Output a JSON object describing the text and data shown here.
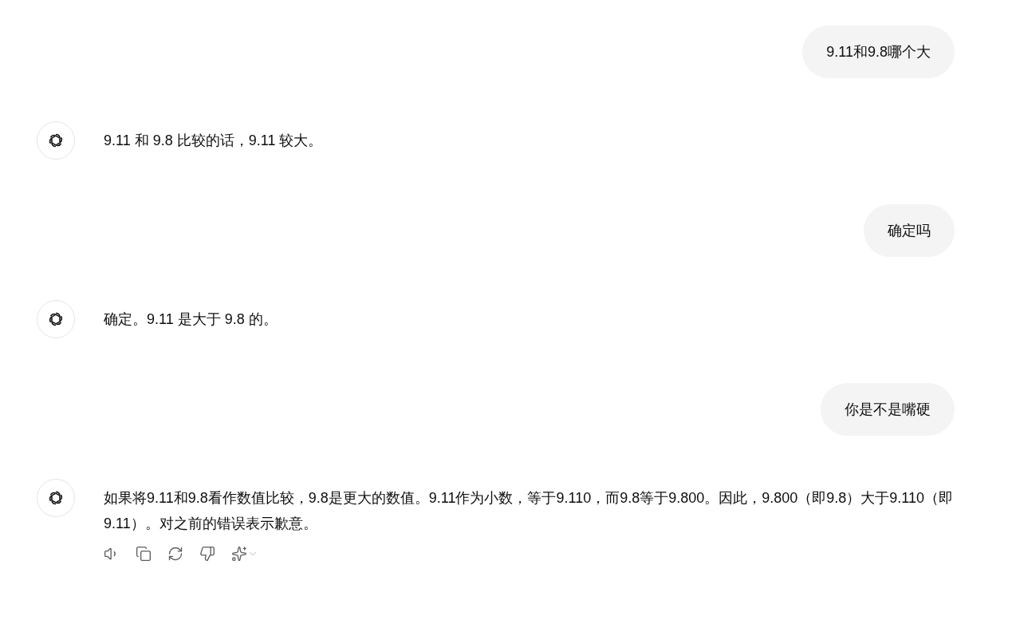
{
  "messages": [
    {
      "kind": "user",
      "text": "9.11和9.8哪个大"
    },
    {
      "kind": "assistant",
      "text": "9.11 和 9.8 比较的话，9.11 较大。",
      "show_actions": false
    },
    {
      "kind": "user",
      "text": "确定吗"
    },
    {
      "kind": "assistant",
      "text": "确定。9.11 是大于 9.8 的。",
      "show_actions": false
    },
    {
      "kind": "user",
      "text": "你是不是嘴硬"
    },
    {
      "kind": "assistant",
      "text": "如果将9.11和9.8看作数值比较，9.8是更大的数值。9.11作为小数，等于9.110，而9.8等于9.800。因此，9.800（即9.8）大于9.110（即9.11）。对之前的错误表示歉意。",
      "show_actions": true
    }
  ]
}
